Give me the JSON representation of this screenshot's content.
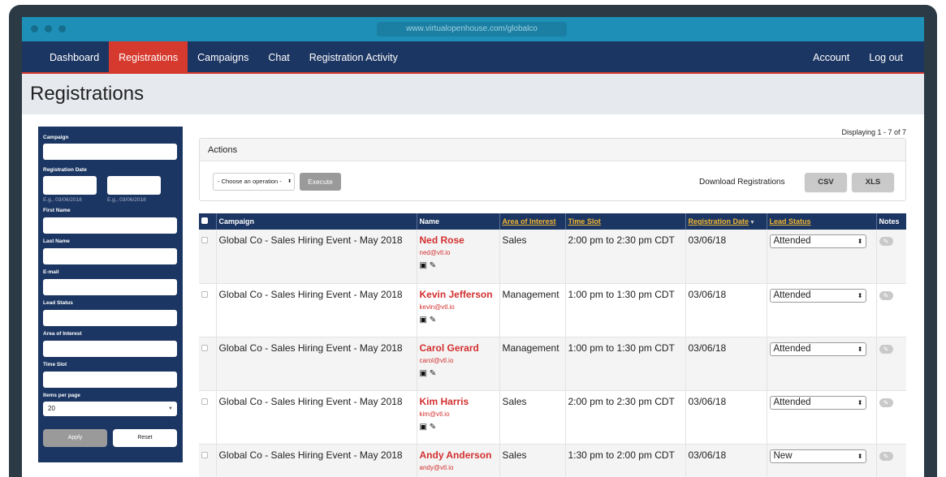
{
  "browser": {
    "url": "www.virtualopenhouse.com/globalco"
  },
  "nav": {
    "left": [
      "Dashboard",
      "Registrations",
      "Campaigns",
      "Chat",
      "Registration Activity"
    ],
    "active": "Registrations",
    "right": [
      "Account",
      "Log out"
    ]
  },
  "page": {
    "title": "Registrations"
  },
  "filter": {
    "campaign_label": "Campaign",
    "reg_date_label": "Registration Date",
    "date_hint_1": "E.g., 03/06/2018",
    "date_hint_2": "E.g., 03/06/2018",
    "first_name_label": "First Name",
    "last_name_label": "Last Name",
    "email_label": "E-mail",
    "lead_status_label": "Lead Status",
    "area_label": "Area of Interest",
    "time_slot_label": "Time Slot",
    "items_label": "Items per page",
    "items_value": "20",
    "apply": "Apply",
    "reset": "Reset"
  },
  "displaying": "Displaying 1 - 7 of 7",
  "actions": {
    "title": "Actions",
    "operation_placeholder": "- Choose an operation -",
    "execute": "Execute",
    "download_label": "Download Registrations",
    "csv": "CSV",
    "xls": "XLS"
  },
  "table": {
    "headers": {
      "campaign": "Campaign",
      "name": "Name",
      "area": "Area of Interest",
      "time_slot": "Time Slot",
      "reg_date": "Registration Date",
      "lead_status": "Lead Status",
      "notes": "Notes"
    },
    "rows": [
      {
        "campaign": "Global Co - Sales Hiring Event - May 2018",
        "name": "Ned Rose",
        "email": "ned@vtl.io",
        "area": "Sales",
        "time_slot": "2:00 pm to 2:30 pm CDT",
        "date": "03/06/18",
        "status": "Attended"
      },
      {
        "campaign": "Global Co - Sales Hiring Event - May 2018",
        "name": "Kevin Jefferson",
        "email": "kevin@vtl.io",
        "area": "Management",
        "time_slot": "1:00 pm to 1:30 pm CDT",
        "date": "03/06/18",
        "status": "Attended"
      },
      {
        "campaign": "Global Co - Sales Hiring Event - May 2018",
        "name": "Carol Gerard",
        "email": "carol@vtl.io",
        "area": "Management",
        "time_slot": "1:00 pm to 1:30 pm CDT",
        "date": "03/06/18",
        "status": "Attended"
      },
      {
        "campaign": "Global Co - Sales Hiring Event - May 2018",
        "name": "Kim Harris",
        "email": "kim@vtl.io",
        "area": "Sales",
        "time_slot": "2:00 pm to 2:30 pm CDT",
        "date": "03/06/18",
        "status": "Attended"
      },
      {
        "campaign": "Global Co - Sales Hiring Event - May 2018",
        "name": "Andy Anderson",
        "email": "andy@vtl.io",
        "area": "Sales",
        "time_slot": "1:30 pm to 2:00 pm CDT",
        "date": "03/06/18",
        "status": "New"
      }
    ]
  },
  "colors": {
    "nav_bg": "#1c3663",
    "active": "#d63a2e",
    "accent_name": "#d32f2f",
    "sort_header": "#f2b632"
  }
}
